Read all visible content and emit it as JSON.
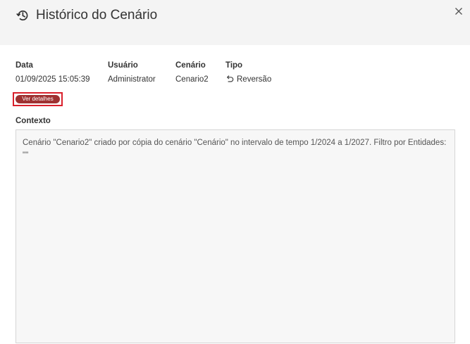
{
  "dialog": {
    "title": "Histórico do Cenário",
    "icon": "history-icon",
    "close_icon": "close-icon"
  },
  "fields": [
    {
      "label": "Data",
      "value": "01/09/2025 15:05:39"
    },
    {
      "label": "Usuário",
      "value": "Administrator"
    },
    {
      "label": "Cenário",
      "value": "Cenario2"
    },
    {
      "label": "Tipo",
      "value": "Reversão",
      "icon": "undo-icon"
    }
  ],
  "details_button": {
    "label": "Ver detalhes",
    "color": "#9e3131",
    "highlight_color": "#d9202c"
  },
  "context": {
    "label": "Contexto",
    "text": "Cenário \"Cenario2\" criado por cópia do cenário \"Cenário\" no intervalo de tempo 1/2024 a 1/2027. Filtro por Entidades: \"\""
  }
}
